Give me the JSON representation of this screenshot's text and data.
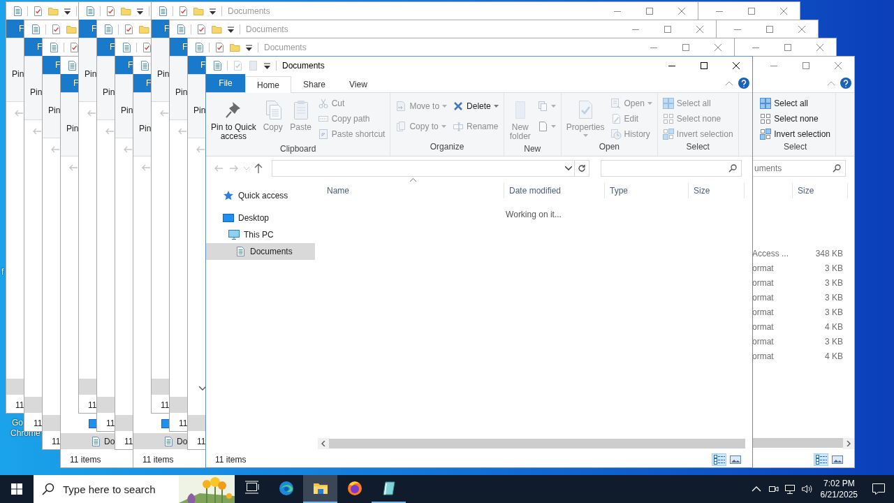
{
  "desktop": {
    "labels": [
      {
        "text": "f"
      },
      {
        "text": "Go"
      },
      {
        "text": "Chrome"
      }
    ]
  },
  "windows": [
    {
      "kind": "titlebar_only"
    },
    {
      "kind": "titlebar_only"
    },
    {
      "kind": "titlebar_only"
    },
    {
      "kind": "right_part",
      "ribbon_group": {
        "label": "Select",
        "items": [
          {
            "label": "Select all",
            "disabled": false,
            "has_menu": false
          },
          {
            "label": "Select none",
            "disabled": false,
            "has_menu": false
          },
          {
            "label": "Invert selection",
            "disabled": false,
            "has_menu": false
          }
        ]
      },
      "search": {
        "placeholder": "uments"
      },
      "columns": [
        "Size"
      ],
      "rows": [
        {
          "type": "Access ...",
          "size": "348 KB"
        },
        {
          "type": "ormat",
          "size": "3 KB"
        },
        {
          "type": "ormat",
          "size": "3 KB"
        },
        {
          "type": "ormat",
          "size": "3 KB"
        },
        {
          "type": "ormat",
          "size": "3 KB"
        },
        {
          "type": "ormat",
          "size": "4 KB"
        },
        {
          "type": "ormat",
          "size": "3 KB"
        },
        {
          "type": "ormat",
          "size": "4 KB"
        }
      ],
      "views": [
        {
          "selected": true
        },
        {
          "selected": false
        }
      ]
    },
    {
      "kind": "strip",
      "file_tab": "F",
      "ribbon_label": "Pin",
      "status": "11"
    },
    {
      "kind": "strip",
      "file_tab": "F",
      "ribbon_label": "Pin",
      "status": "11"
    },
    {
      "kind": "strip",
      "file_tab": "F",
      "ribbon_label": "Pin",
      "status": "11"
    },
    {
      "kind": "strip",
      "file_tab": "F",
      "ribbon_label": "Pin",
      "status": "11 items",
      "nav_item": "Do"
    },
    {
      "kind": "strip",
      "file_tab": "F",
      "ribbon_label": "Pin",
      "status": "11"
    },
    {
      "kind": "strip",
      "file_tab": "F",
      "ribbon_label": "Pin",
      "status": "11"
    },
    {
      "kind": "strip",
      "file_tab": "F",
      "ribbon_label": "Pin",
      "status": "11"
    },
    {
      "kind": "strip",
      "file_tab": "F",
      "ribbon_label": "Pin",
      "status": "11 items",
      "nav_item": "Do"
    },
    {
      "kind": "strip",
      "active": false,
      "title": "Documents",
      "file_tab": "F",
      "ribbon_label": "Pin",
      "status": "11"
    },
    {
      "kind": "strip",
      "active": false,
      "title": "Documents",
      "file_tab": "F",
      "ribbon_label": "Pin",
      "status": "11"
    },
    {
      "kind": "strip",
      "active": false,
      "title": "Documents",
      "file_tab": "F",
      "ribbon_label": "Pin",
      "status": "11",
      "nav_chevron": true
    },
    {
      "kind": "full",
      "active": true,
      "title": "Documents",
      "tabs": [
        {
          "kind": "file",
          "label": "File",
          "selected": false
        },
        {
          "kind": "tab",
          "label": "Home",
          "selected": true
        },
        {
          "kind": "tab",
          "label": "Share",
          "selected": false
        },
        {
          "kind": "tab",
          "label": "View",
          "selected": false
        }
      ],
      "ribbon": [
        {
          "label": "Clipboard",
          "items": [
            {
              "kind": "large",
              "label": "Pin to Quick\naccess",
              "disabled": false,
              "has_menu": false
            },
            {
              "kind": "large",
              "label": "Copy",
              "disabled": true,
              "has_menu": false
            },
            {
              "kind": "large",
              "label": "Paste",
              "disabled": true,
              "has_menu": false
            },
            {
              "kind": "stack",
              "items": [
                {
                  "label": "Cut",
                  "disabled": true,
                  "has_menu": false
                },
                {
                  "label": "Copy path",
                  "disabled": true,
                  "has_menu": false
                },
                {
                  "label": "Paste shortcut",
                  "disabled": true,
                  "has_menu": false
                }
              ]
            }
          ]
        },
        {
          "label": "Organize",
          "items": [
            {
              "kind": "stack",
              "items": [
                {
                  "label": "Move to",
                  "disabled": true,
                  "has_menu": true
                },
                {
                  "label": "Copy to",
                  "disabled": true,
                  "has_menu": true
                }
              ]
            },
            {
              "kind": "stack",
              "items": [
                {
                  "label": "Delete",
                  "disabled": false,
                  "has_menu": true
                },
                {
                  "label": "Rename",
                  "disabled": true,
                  "has_menu": false
                }
              ]
            }
          ]
        },
        {
          "label": "New",
          "items": [
            {
              "kind": "large",
              "label": "New\nfolder",
              "disabled": true,
              "has_menu": false
            },
            {
              "kind": "stack",
              "items": [
                {
                  "disabled": true,
                  "has_menu": true
                },
                {
                  "disabled": true,
                  "has_menu": true
                }
              ]
            }
          ]
        },
        {
          "label": "Open",
          "items": [
            {
              "kind": "large",
              "label": "Properties",
              "disabled": true,
              "has_menu": true
            },
            {
              "kind": "stack",
              "items": [
                {
                  "label": "Open",
                  "disabled": true,
                  "has_menu": true
                },
                {
                  "label": "Edit",
                  "disabled": true,
                  "has_menu": false
                },
                {
                  "label": "History",
                  "disabled": true,
                  "has_menu": false
                }
              ]
            }
          ]
        },
        {
          "label": "Select",
          "items": [
            {
              "kind": "stack",
              "items": [
                {
                  "label": "Select all",
                  "disabled": true,
                  "has_menu": false
                },
                {
                  "label": "Select none",
                  "disabled": true,
                  "has_menu": false
                },
                {
                  "label": "Invert selection",
                  "disabled": true,
                  "has_menu": false
                }
              ]
            }
          ]
        }
      ],
      "nav": [
        {
          "label": "Quick access",
          "selected": false
        },
        {
          "label": "Desktop",
          "selected": false,
          "children": [
            {
              "label": "This PC",
              "selected": false,
              "children": [
                {
                  "label": "Documents",
                  "selected": true
                }
              ]
            }
          ]
        }
      ],
      "columns": [
        "Name",
        "Date modified",
        "Type",
        "Size"
      ],
      "message": "Working on it...",
      "status": "11 items",
      "views": [
        {
          "selected": true
        },
        {
          "selected": false
        }
      ]
    }
  ],
  "taskbar": {
    "search_placeholder": "Type here to search",
    "apps": [
      {
        "kind": "taskview",
        "active": false,
        "running": false
      },
      {
        "kind": "edge",
        "active": false,
        "running": false
      },
      {
        "kind": "explorer",
        "active": true,
        "running": true
      },
      {
        "kind": "firefox",
        "active": false,
        "running": false
      },
      {
        "kind": "notepad",
        "active": false,
        "running": true
      }
    ],
    "time": "7:02 PM",
    "date": "6/21/2025"
  }
}
